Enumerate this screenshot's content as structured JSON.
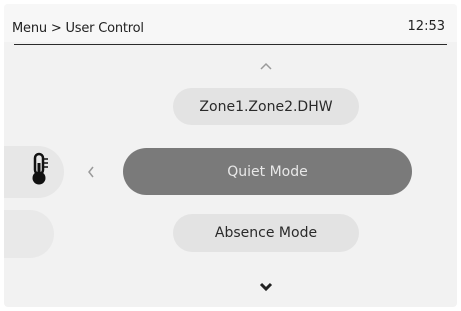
{
  "header": {
    "breadcrumb": "Menu > User Control",
    "time": "12:53"
  },
  "menu": {
    "prev_item": "Zone1.Zone2.DHW",
    "current_item": "Quiet Mode",
    "next_item": "Absence Mode"
  },
  "icons": {
    "side": "thermometer-icon",
    "up": "chevron-up-icon",
    "left": "chevron-left-icon",
    "down": "chevron-down-icon"
  },
  "colors": {
    "selected_pill": "#7a7a7a",
    "pill": "#e3e3e3",
    "background": "#f2f2f2"
  }
}
